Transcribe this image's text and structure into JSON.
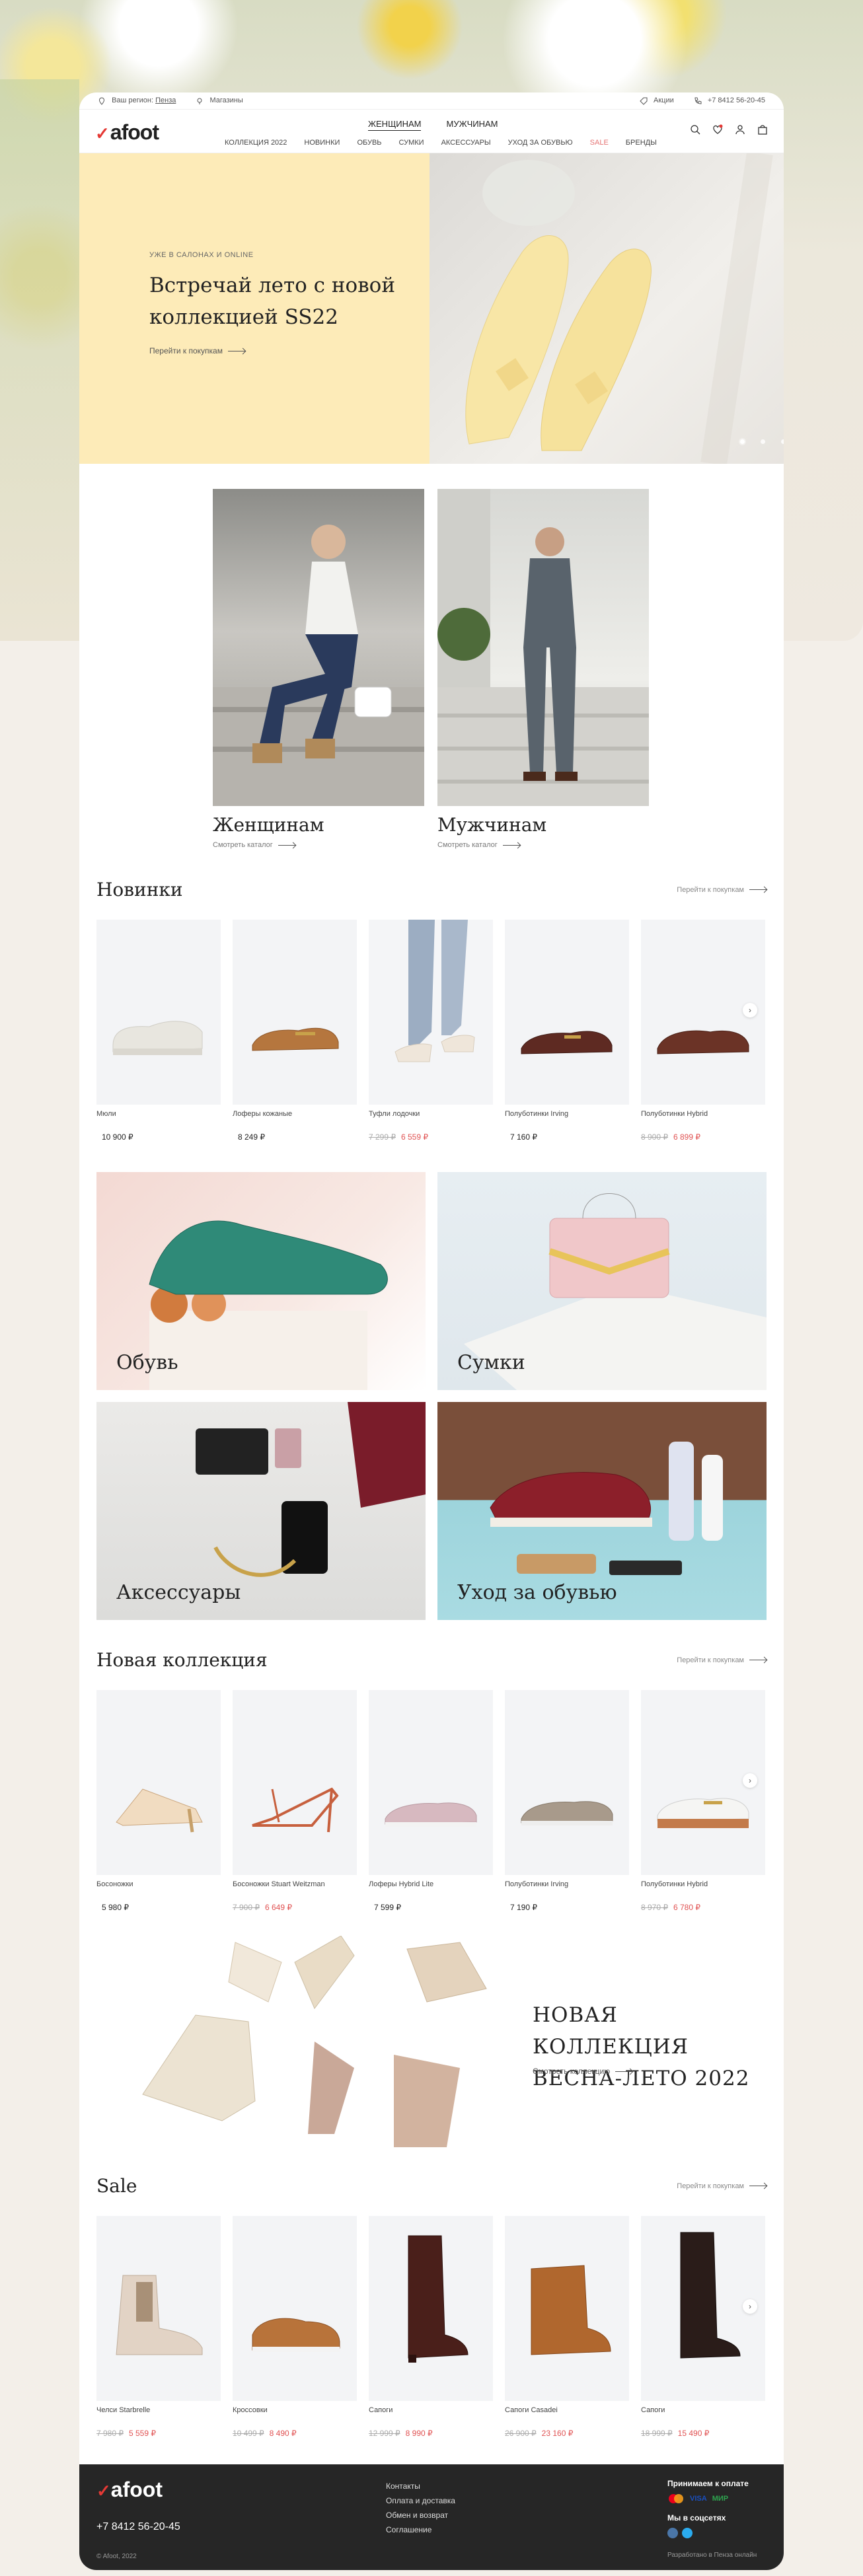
{
  "topbar": {
    "region_label": "Ваш регион:",
    "region_value": "Пенза",
    "stores": "Магазины",
    "promo": "Акции",
    "phone": "+7 8412 56-20-45"
  },
  "header": {
    "logo": "afoot",
    "gender": [
      "ЖЕНЩИНАМ",
      "МУЖЧИНАМ"
    ],
    "nav": [
      "КОЛЛЕКЦИЯ 2022",
      "НОВИНКИ",
      "ОБУВЬ",
      "СУМКИ",
      "АКСЕССУАРЫ",
      "УХОД ЗА ОБУВЬЮ",
      "SALE",
      "БРЕНДЫ"
    ]
  },
  "hero": {
    "kicker": "УЖЕ В САЛОНАХ И ONLINE",
    "title": "Встречай лето с новой коллекцией SS22",
    "link": "Перейти к покупкам",
    "slides": 5,
    "active_slide": 1
  },
  "gender_cards": [
    {
      "title": "Женщинам",
      "link": "Смотреть каталог"
    },
    {
      "title": "Мужчинам",
      "link": "Смотреть каталог"
    }
  ],
  "new_items": {
    "title": "Новинки",
    "all_link": "Перейти к покупкам",
    "products": [
      {
        "name": "Мюли",
        "price": "10 900 ₽",
        "old": ""
      },
      {
        "name": "Лоферы кожаные",
        "price": "8 249 ₽",
        "old": ""
      },
      {
        "name": "Туфли лодочки",
        "price": "6 559 ₽",
        "old": "7 299 ₽"
      },
      {
        "name": "Полуботинки Irving",
        "price": "7 160 ₽",
        "old": ""
      },
      {
        "name": "Полуботинки Hybrid",
        "price": "6 899 ₽",
        "old": "8 900 ₽"
      }
    ]
  },
  "categories": [
    "Обувь",
    "Сумки",
    "Аксессуары",
    "Уход за обувью"
  ],
  "new_collection": {
    "title": "Новая коллекция",
    "all_link": "Перейти к покупкам",
    "products": [
      {
        "name": "Босоножки",
        "price": "5 980 ₽",
        "old": ""
      },
      {
        "name": "Босоножки Stuart Weitzman",
        "price": "6 649 ₽",
        "old": "7 900 ₽"
      },
      {
        "name": "Лоферы Hybrid Lite",
        "price": "7 599 ₽",
        "old": ""
      },
      {
        "name": "Полуботинки Irving",
        "price": "7 190 ₽",
        "old": ""
      },
      {
        "name": "Полуботинки Hybrid",
        "price": "6 780 ₽",
        "old": "8 970 ₽"
      }
    ]
  },
  "banner": {
    "title_line1": "НОВАЯ КОЛЛЕКЦИЯ",
    "title_line2": "ВЕСНА-ЛЕТО 2022",
    "link": "Смотреть коллекцию"
  },
  "sale": {
    "title": "Sale",
    "all_link": "Перейти к покупкам",
    "products": [
      {
        "name": "Челси Starbrelle",
        "price": "5 559 ₽",
        "old": "7 980 ₽"
      },
      {
        "name": "Кроссовки",
        "price": "8 490 ₽",
        "old": "10 499 ₽"
      },
      {
        "name": "Сапоги",
        "price": "8 990 ₽",
        "old": "12 999 ₽"
      },
      {
        "name": "Сапоги Casadei",
        "price": "23 160 ₽",
        "old": "26 900 ₽"
      },
      {
        "name": "Сапоги",
        "price": "15 490 ₽",
        "old": "18 999 ₽"
      }
    ]
  },
  "footer": {
    "logo": "afoot",
    "phone": "+7 8412 56-20-45",
    "copyright": "© Afoot, 2022",
    "links": [
      "Контакты",
      "Оплата и доставка",
      "Обмен и возврат",
      "Соглашение"
    ],
    "pay_title": "Принимаем к оплате",
    "pay_methods": [
      "VISA",
      "МИР"
    ],
    "social_title": "Мы в соцсетях",
    "developer": "Разработано в Пенза онлайн"
  },
  "colors": {
    "accent": "#e53935",
    "sale": "#e05252",
    "hero_bg": "#fdebb8",
    "footer_bg": "#262626"
  }
}
